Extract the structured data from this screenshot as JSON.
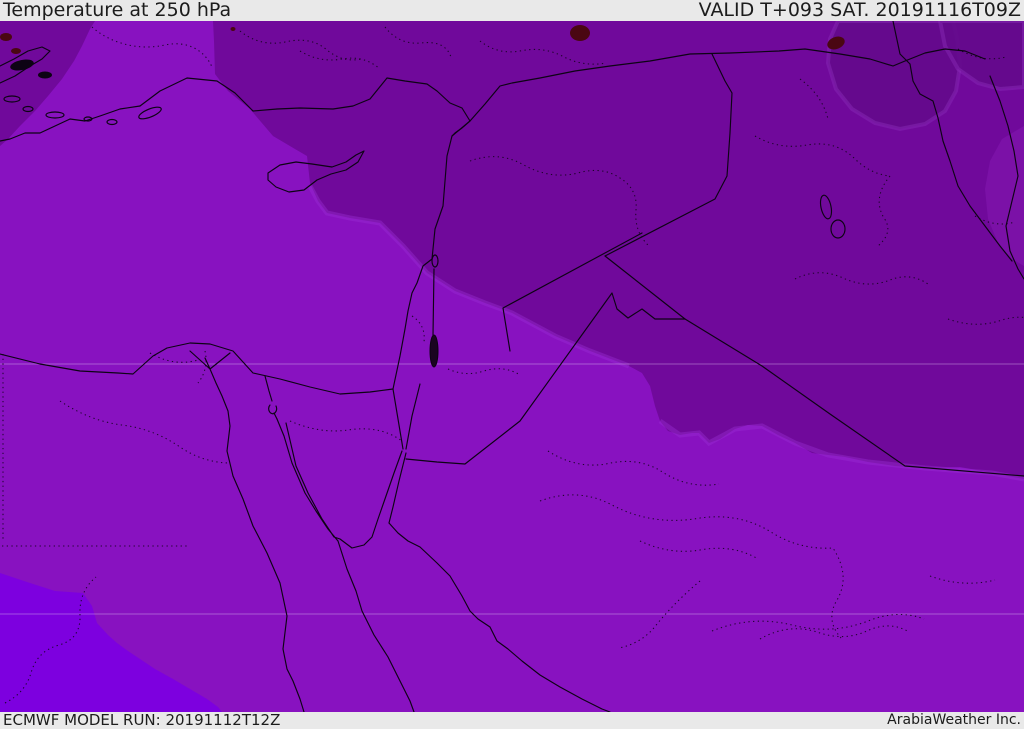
{
  "header": {
    "title": "Temperature at 250 hPa",
    "valid": "VALID T+093 SAT. 20191116T09Z"
  },
  "footer": {
    "model_run": "ECMWF MODEL RUN: 20191112T12Z",
    "brand": "ArabiaWeather Inc."
  },
  "map": {
    "region": "Middle East / Eastern Mediterranean",
    "colors": {
      "band_warm": "#7d00df",
      "band_mild": "#8812c0",
      "band_cool": "#70099b",
      "band_coldest": "#640a8c",
      "band_cool_light": "#7d13a9",
      "boundary_fringe": "#9a30d4",
      "lake_dark": "#4a0712",
      "dead_sea": "#1a0420",
      "bar_bg": "#e9e9e9",
      "bar_text": "#1c1c1c"
    }
  }
}
